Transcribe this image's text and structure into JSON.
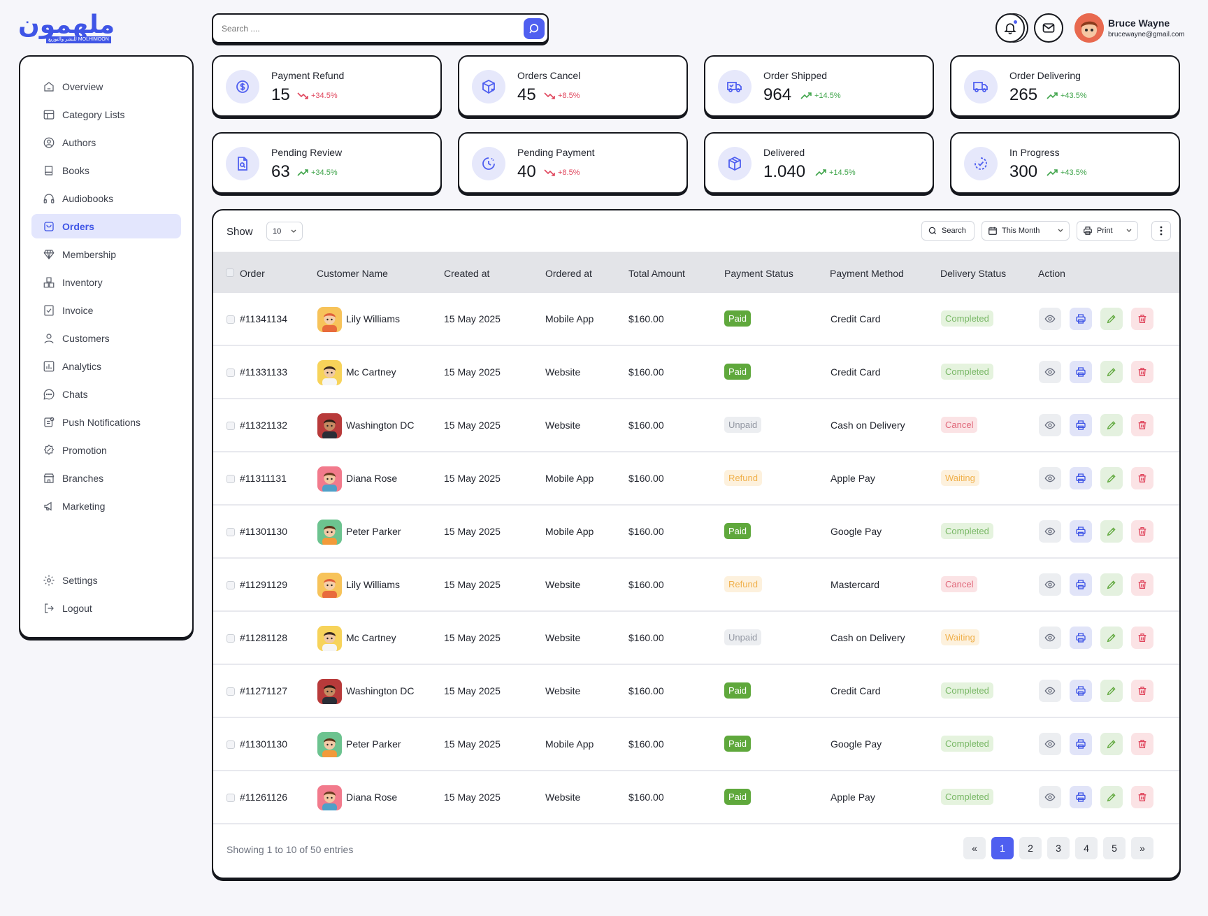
{
  "brand": {
    "logo_text": "ملهمون",
    "logo_sub": "للنشر والتوزيع MOLHIMOON"
  },
  "header": {
    "search_placeholder": "Search ....",
    "user": {
      "name": "Bruce Wayne",
      "email": "brucewayne@gmail.com"
    }
  },
  "sidebar": {
    "items": [
      {
        "label": "Overview",
        "icon": "home-icon"
      },
      {
        "label": "Category Lists",
        "icon": "category-icon"
      },
      {
        "label": "Authors",
        "icon": "user-circle-icon"
      },
      {
        "label": "Books",
        "icon": "book-icon"
      },
      {
        "label": "Audiobooks",
        "icon": "headphones-icon"
      },
      {
        "label": "Orders",
        "icon": "orders-icon",
        "active": true
      },
      {
        "label": "Membership",
        "icon": "diamond-icon"
      },
      {
        "label": "Inventory",
        "icon": "boxes-icon"
      },
      {
        "label": "Invoice",
        "icon": "invoice-icon"
      },
      {
        "label": "Customers",
        "icon": "person-icon"
      },
      {
        "label": "Analytics",
        "icon": "analytics-icon"
      },
      {
        "label": "Chats",
        "icon": "chat-icon"
      },
      {
        "label": "Push Notifications",
        "icon": "notification-icon"
      },
      {
        "label": "Promotion",
        "icon": "promotion-icon"
      },
      {
        "label": "Branches",
        "icon": "store-icon"
      },
      {
        "label": "Marketing",
        "icon": "megaphone-icon"
      }
    ],
    "bottom": [
      {
        "label": "Settings",
        "icon": "gear-icon"
      },
      {
        "label": "Logout",
        "icon": "logout-icon"
      }
    ]
  },
  "stats": [
    {
      "label": "Payment Refund",
      "value": "15",
      "trend": "+34.5%",
      "direction": "down",
      "icon": "dollar-refund-icon"
    },
    {
      "label": "Orders Cancel",
      "value": "45",
      "trend": "+8.5%",
      "direction": "down",
      "icon": "box-cancel-icon"
    },
    {
      "label": "Order Shipped",
      "value": "964",
      "trend": "+14.5%",
      "direction": "up",
      "icon": "truck-check-icon"
    },
    {
      "label": "Order Delivering",
      "value": "265",
      "trend": "+43.5%",
      "direction": "up",
      "icon": "truck-icon"
    },
    {
      "label": "Pending Review",
      "value": "63",
      "trend": "+34.5%",
      "direction": "up",
      "icon": "file-search-icon"
    },
    {
      "label": "Pending Payment",
      "value": "40",
      "trend": "+8.5%",
      "direction": "down",
      "icon": "clock-icon"
    },
    {
      "label": "Delivered",
      "value": "1.040",
      "trend": "+14.5%",
      "direction": "up",
      "icon": "box-icon"
    },
    {
      "label": "In Progress",
      "value": "300",
      "trend": "+43.5%",
      "direction": "up",
      "icon": "progress-check-icon"
    }
  ],
  "table": {
    "show_label": "Show",
    "page_size": "10",
    "search_label": "Search",
    "period_label": "This Month",
    "print_label": "Print",
    "columns": [
      "Order",
      "Customer Name",
      "Created at",
      "Ordered at",
      "Total Amount",
      "Payment Status",
      "Payment Method",
      "Delivery Status",
      "Action"
    ],
    "rows": [
      {
        "order": "#11341134",
        "customer": "Lily Williams",
        "avatar": "lily",
        "created": "15 May 2025",
        "ordered": "Mobile App",
        "amount": "$160.00",
        "payment_status": "Paid",
        "method": "Credit Card",
        "delivery": "Completed"
      },
      {
        "order": "#11331133",
        "customer": "Mc Cartney",
        "avatar": "mc",
        "created": "15 May 2025",
        "ordered": "Website",
        "amount": "$160.00",
        "payment_status": "Paid",
        "method": "Credit Card",
        "delivery": "Completed"
      },
      {
        "order": "#11321132",
        "customer": "Washington DC",
        "avatar": "wash",
        "created": "15 May 2025",
        "ordered": "Website",
        "amount": "$160.00",
        "payment_status": "Unpaid",
        "method": "Cash on Delivery",
        "delivery": "Cancel"
      },
      {
        "order": "#11311131",
        "customer": "Diana Rose",
        "avatar": "diana",
        "created": "15 May 2025",
        "ordered": "Mobile App",
        "amount": "$160.00",
        "payment_status": "Refund",
        "method": "Apple Pay",
        "delivery": "Waiting"
      },
      {
        "order": "#11301130",
        "customer": "Peter Parker",
        "avatar": "peter",
        "created": "15 May 2025",
        "ordered": "Mobile App",
        "amount": "$160.00",
        "payment_status": "Paid",
        "method": "Google Pay",
        "delivery": "Completed"
      },
      {
        "order": "#11291129",
        "customer": "Lily Williams",
        "avatar": "lily",
        "created": "15 May 2025",
        "ordered": "Website",
        "amount": "$160.00",
        "payment_status": "Refund",
        "method": "Mastercard",
        "delivery": "Cancel"
      },
      {
        "order": "#11281128",
        "customer": "Mc Cartney",
        "avatar": "mc",
        "created": "15 May 2025",
        "ordered": "Website",
        "amount": "$160.00",
        "payment_status": "Unpaid",
        "method": "Cash on Delivery",
        "delivery": "Waiting"
      },
      {
        "order": "#11271127",
        "customer": "Washington DC",
        "avatar": "wash",
        "created": "15 May 2025",
        "ordered": "Website",
        "amount": "$160.00",
        "payment_status": "Paid",
        "method": "Credit Card",
        "delivery": "Completed"
      },
      {
        "order": "#11301130",
        "customer": "Peter Parker",
        "avatar": "peter",
        "created": "15 May 2025",
        "ordered": "Mobile App",
        "amount": "$160.00",
        "payment_status": "Paid",
        "method": "Google Pay",
        "delivery": "Completed"
      },
      {
        "order": "#11261126",
        "customer": "Diana Rose",
        "avatar": "diana",
        "created": "15 May 2025",
        "ordered": "Website",
        "amount": "$160.00",
        "payment_status": "Paid",
        "method": "Apple Pay",
        "delivery": "Completed"
      }
    ],
    "footer": "Showing 1 to 10 of 50 entries",
    "pagination": {
      "first": "«",
      "pages": [
        "1",
        "2",
        "3",
        "4",
        "5"
      ],
      "last": "»",
      "current": "1"
    }
  },
  "colors": {
    "accent": "#4f5ff0",
    "paid_bg": "#5fa83c",
    "paid_fg": "#ffffff",
    "unpaid_bg": "#eceef1",
    "unpaid_fg": "#9297a2",
    "refund_bg": "#fdf1dd",
    "refund_fg": "#f0b04b",
    "completed_bg": "#e5f3de",
    "completed_fg": "#79b866",
    "cancel_bg": "#fbe3e5",
    "cancel_fg": "#e0687a",
    "waiting_bg": "#fdf1dd",
    "waiting_fg": "#f0b04b"
  }
}
